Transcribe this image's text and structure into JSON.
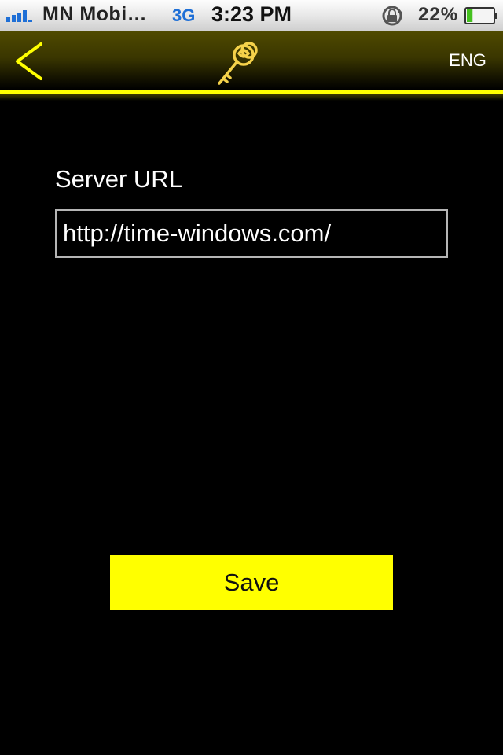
{
  "status_bar": {
    "carrier": "MN Mobi…",
    "network": "3G",
    "time": "3:23 PM",
    "battery_percent": "22",
    "battery_unit": "%",
    "signal_icon": "signal-bars-icon",
    "rotation_lock_icon": "rotation-lock-icon",
    "battery_icon": "battery-icon",
    "battery_level": 0.22
  },
  "nav": {
    "back_icon": "chevron-left-icon",
    "logo_icon": "key-icon",
    "language_label": "ENG"
  },
  "form": {
    "server_url_label": "Server URL",
    "server_url_value": "http://time-windows.com/",
    "save_label": "Save"
  },
  "colors": {
    "accent": "#ffff00",
    "background": "#000000",
    "navbar": "#4f4a00",
    "network_text": "#1e6fd6",
    "battery_fill": "#44c01e"
  }
}
